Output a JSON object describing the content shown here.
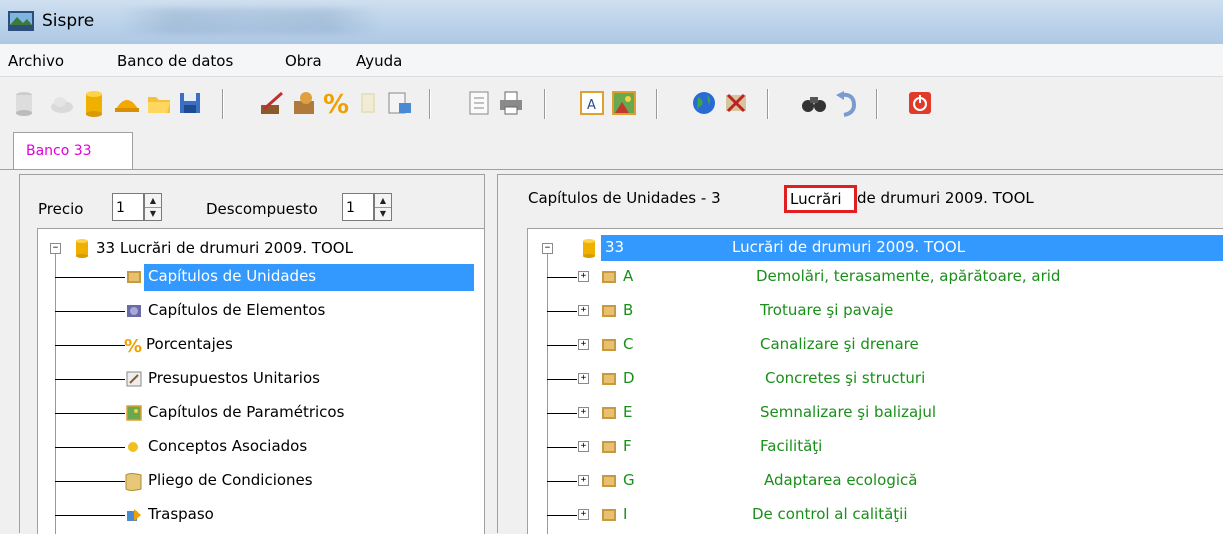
{
  "window": {
    "title": "Sispre"
  },
  "menu": [
    "Archivo",
    "Banco de datos",
    "Obra",
    "Ayuda"
  ],
  "tabs": [
    {
      "label": "Banco 33",
      "color": "#e000d8"
    }
  ],
  "left": {
    "precio_label": "Precio",
    "precio_value": "1",
    "descompuesto_label": "Descompuesto",
    "descompuesto_value": "1",
    "root_label": "33 Lucrări de drumuri 2009. TOOL",
    "items": [
      {
        "label": "Capítulos de Unidades",
        "icon": "unit-chapter-icon",
        "selected": true
      },
      {
        "label": "Capítulos de Elementos",
        "icon": "element-chapter-icon"
      },
      {
        "label": "Porcentajes",
        "icon": "percent-icon"
      },
      {
        "label": "Presupuestos Unitarios",
        "icon": "unit-budget-icon"
      },
      {
        "label": "Capítulos de Paramétricos",
        "icon": "parametric-icon"
      },
      {
        "label": "Conceptos Asociados",
        "icon": "dot-icon"
      },
      {
        "label": "Pliego de Condiciones",
        "icon": "scroll-icon"
      },
      {
        "label": "Traspaso",
        "icon": "transfer-icon"
      }
    ]
  },
  "right": {
    "header_prefix": "Capítulos de Unidades - 3",
    "header_highlight": "Lucrări",
    "header_suffix": "de drumuri 2009. TOOL",
    "root": {
      "code": "33",
      "label": "Lucrări de drumuri 2009. TOOL"
    },
    "chapters": [
      {
        "code": "A",
        "label": "Demolări, terasamente, apărătoare, arid"
      },
      {
        "code": "B",
        "label": "Trotuare şi pavaje"
      },
      {
        "code": "C",
        "label": "Canalizare şi drenare"
      },
      {
        "code": "D",
        "label": "Concretes şi structuri"
      },
      {
        "code": "E",
        "label": "Semnalizare şi balizajul"
      },
      {
        "code": "F",
        "label": "Facilităţi"
      },
      {
        "code": "G",
        "label": "Adaptarea ecologică"
      },
      {
        "code": "I",
        "label": "De control al calităţii"
      }
    ],
    "chapter_color": "#1a8f1a"
  }
}
